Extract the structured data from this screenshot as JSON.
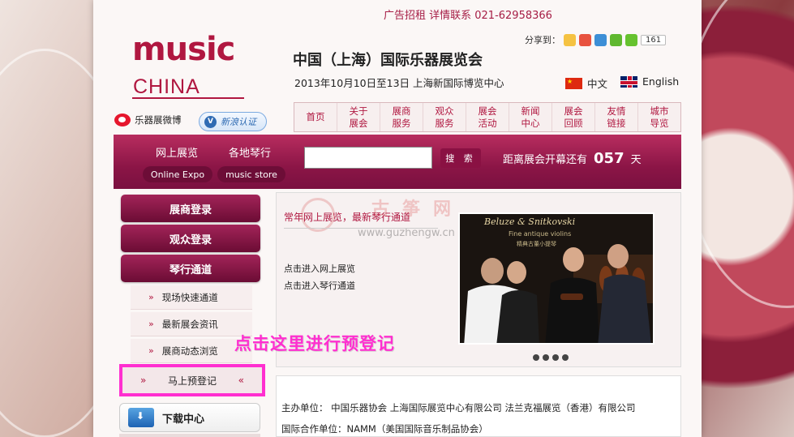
{
  "header": {
    "ad_text": "广告招租 详情联系 021-62958366",
    "logo_top": "music",
    "logo_bottom": "CHINA",
    "title": "中国（上海）国际乐器展览会",
    "date_text": "2013年10月10日至13日   上海新国际博览中心",
    "share_label": "分享到：",
    "share_count": "161",
    "lang_cn": "中文",
    "lang_en": "English"
  },
  "social": {
    "weibo_label": "乐器展微博",
    "verify_label": "新浪认证"
  },
  "nav": {
    "items": [
      "首页",
      "关于\n展会",
      "展商\n服务",
      "观众\n服务",
      "展会\n活动",
      "新闻\n中心",
      "展会\n回顾",
      "友情\n链接",
      "城市\n导览"
    ]
  },
  "band": {
    "online_expo_cn": "网上展览",
    "music_store_cn": "各地琴行",
    "online_expo_en": "Online Expo",
    "music_store_en": "music store",
    "search_value": "",
    "search_button": "搜 索",
    "countdown_prefix": "距离展会开幕还有",
    "countdown_days": "057",
    "countdown_suffix": "天"
  },
  "sidebar": {
    "buttons": [
      "展商登录",
      "观众登录",
      "琴行通道"
    ],
    "sub_items": [
      "现场快速通道",
      "最新展会资讯",
      "展商动态浏览"
    ],
    "arrow": "»",
    "prereg_left": "»",
    "prereg_label": "马上预登记",
    "prereg_right": "«",
    "download": "下载中心"
  },
  "content": {
    "heading": "常年网上展览，最新琴行通道",
    "link1": "点击进入网上展览",
    "link2": "点击进入琴行通道",
    "watermark_text": "古筝网",
    "watermark_url": "www.guzhengw.cn",
    "photo_sign": "Beluze & Snitkovski",
    "photo_sign2": "Fine antique violins",
    "photo_sign3": "精典古董小提琴",
    "slides_total": 4
  },
  "annotation": {
    "prereg_hint": "点击这里进行预登记"
  },
  "info": {
    "organizer": "主办单位：  中国乐器协会 上海国际展览中心有限公司 法兰克福展览（香港）有限公司",
    "partner": "国际合作单位：NAMM（美国国际音乐制品协会）"
  },
  "colors": {
    "brand": "#b01740",
    "band": "#8b1546",
    "highlight": "#ff2fd0"
  }
}
